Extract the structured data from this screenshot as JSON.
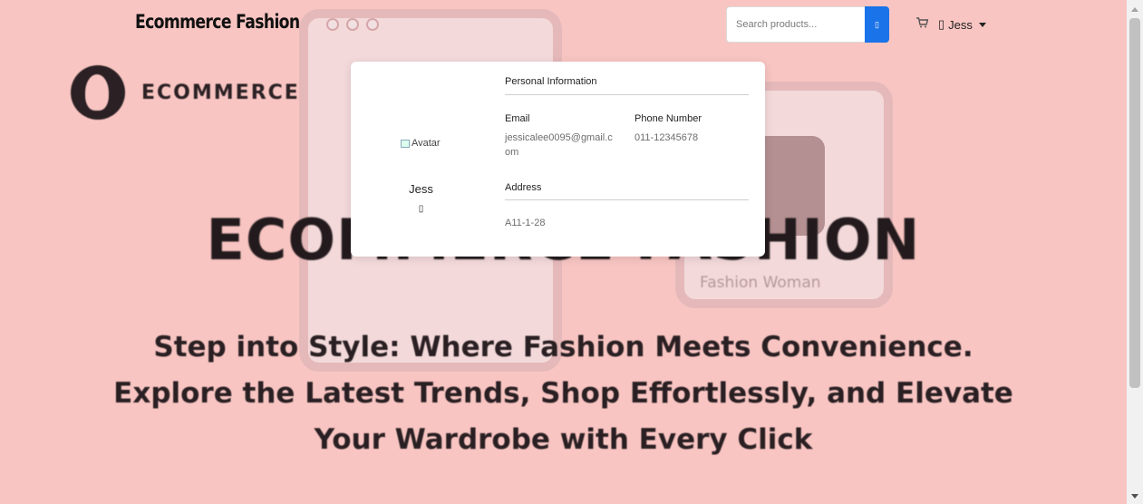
{
  "navbar": {
    "brand": "Ecommerce Fashion",
    "search_placeholder": "Search products...",
    "search_button_icon": "square-icon",
    "cart_icon": "cart-icon",
    "user_icon_glyph": "▯",
    "user_name": "Jess"
  },
  "hero": {
    "logo_text": "ECOMMERCE",
    "title": "ECOMMERCE FASHION",
    "badge": "Fashion Woman",
    "tagline_lines": [
      "Step into Style: Where Fashion Meets Convenience.",
      "Explore the Latest Trends, Shop Effortlessly, and Elevate",
      "Your Wardrobe with Every Click"
    ]
  },
  "profile_card": {
    "avatar_alt": "Avatar",
    "name": "Jess",
    "edit_icon_glyph": "▯",
    "personal_info_title": "Personal Information",
    "email_label": "Email",
    "email_value": "jessicalee0095@gmail.com",
    "phone_label": "Phone Number",
    "phone_value": "011-12345678",
    "address_title": "Address",
    "address_value": "A11-1-28"
  },
  "colors": {
    "hero_bg": "#f8c5c2",
    "accent_blue": "#1a73e8"
  }
}
